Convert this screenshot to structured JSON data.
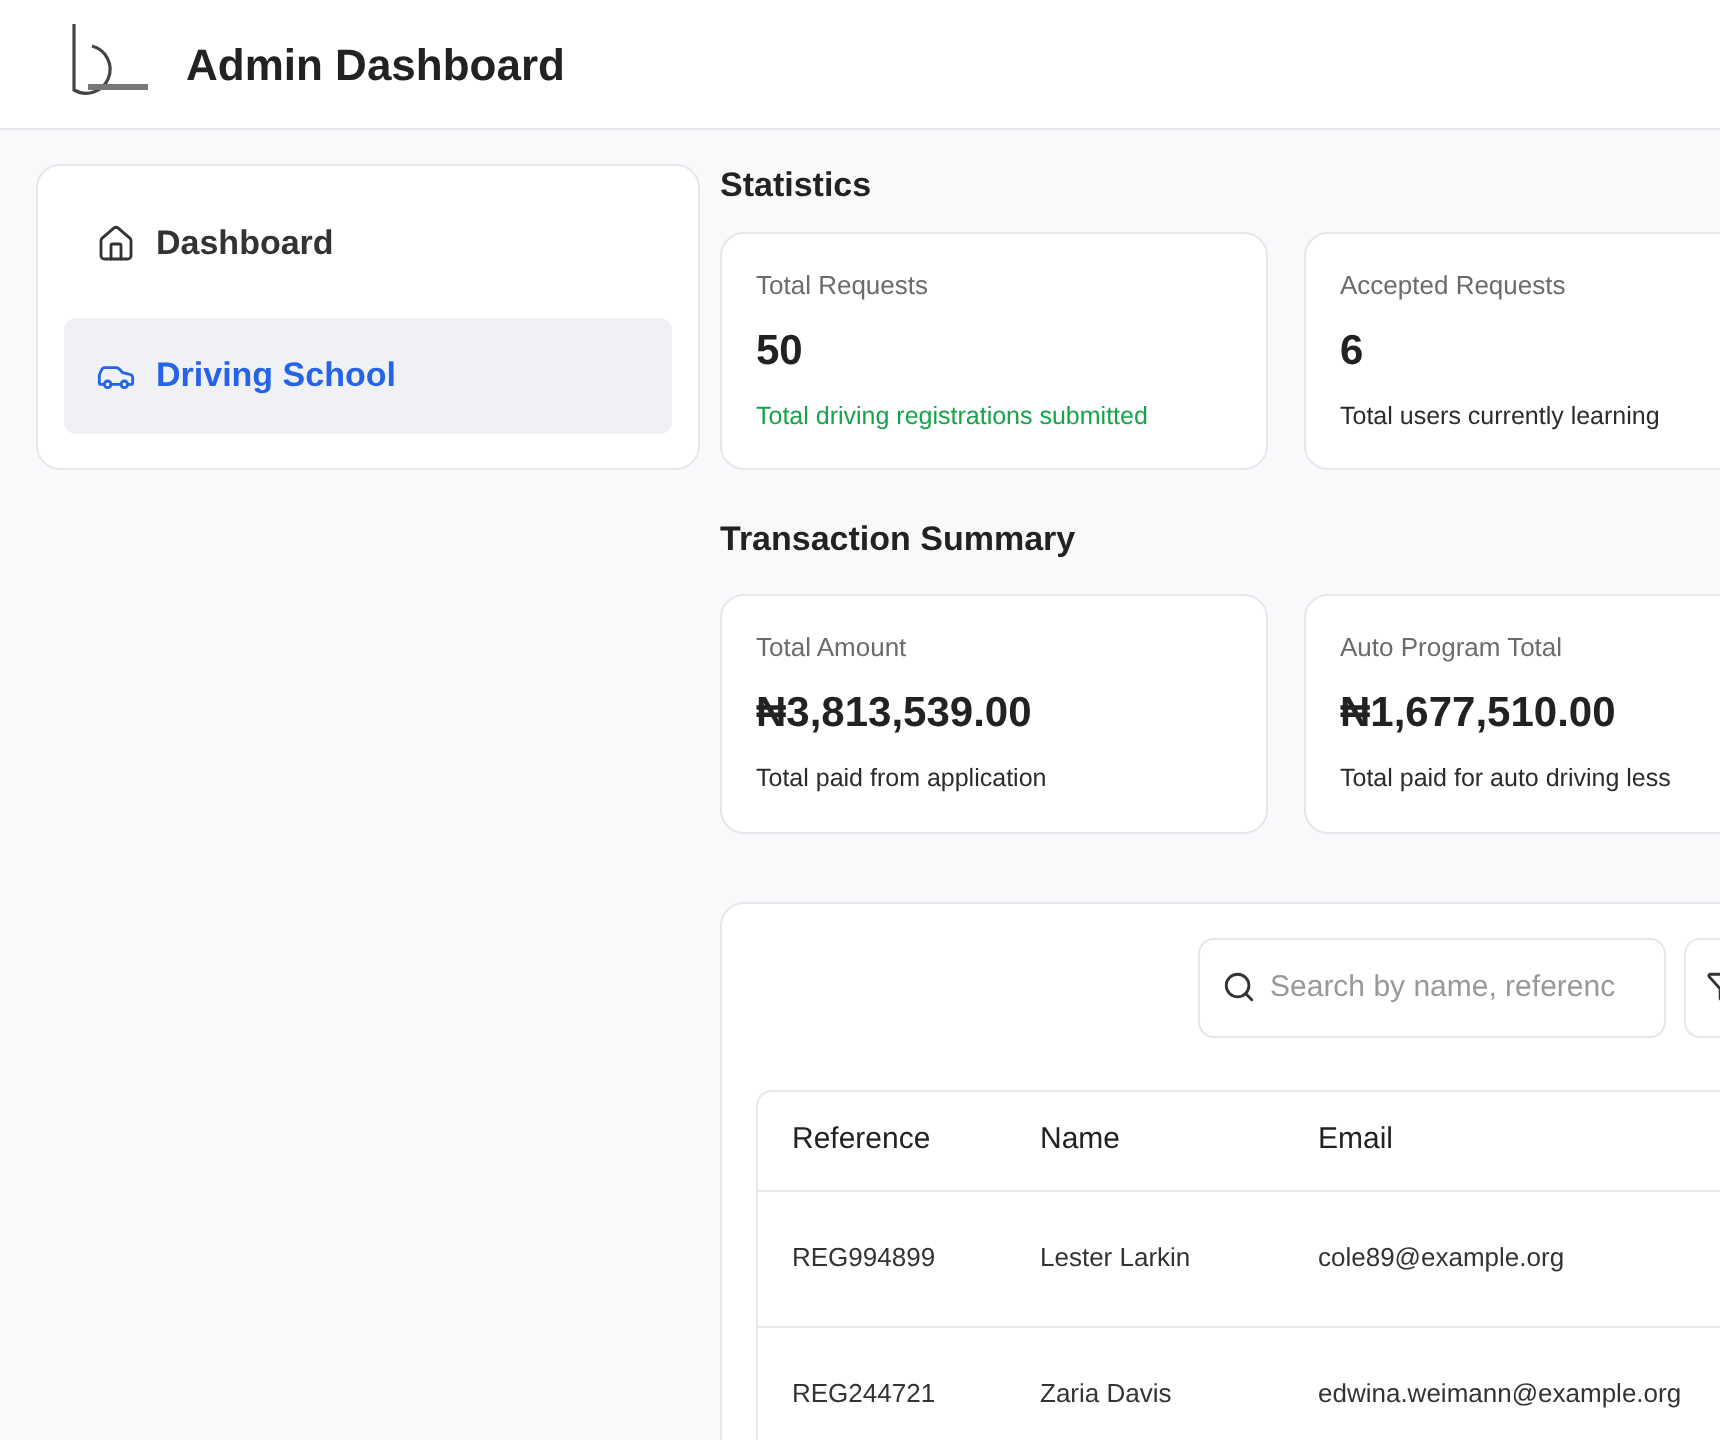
{
  "header": {
    "title": "Admin Dashboard"
  },
  "sidebar": {
    "items": [
      {
        "label": "Dashboard",
        "selected": false
      },
      {
        "label": "Driving School",
        "selected": true
      }
    ]
  },
  "statistics": {
    "title": "Statistics",
    "cards": [
      {
        "label": "Total Requests",
        "value": "50",
        "note": "Total driving registrations submitted",
        "kind": "positive"
      },
      {
        "label": "Accepted Requests",
        "value": "6",
        "note": "Total users currently learning",
        "kind": "plain"
      }
    ]
  },
  "transactions": {
    "title": "Transaction Summary",
    "cards": [
      {
        "label": "Total Amount",
        "value": "₦3,813,539.00",
        "note": "Total paid from application"
      },
      {
        "label": "Auto Program Total",
        "value": "₦1,677,510.00",
        "note": "Total paid for auto driving less"
      }
    ]
  },
  "table": {
    "search": {
      "placeholder": "Search by name, referenc"
    },
    "columns": [
      "Reference",
      "Name",
      "Email"
    ],
    "rows": [
      [
        "REG994899",
        "Lester Larkin",
        "cole89@example.org"
      ],
      [
        "REG244721",
        "Zaria Davis",
        "edwina.weimann@example.org"
      ]
    ]
  }
}
